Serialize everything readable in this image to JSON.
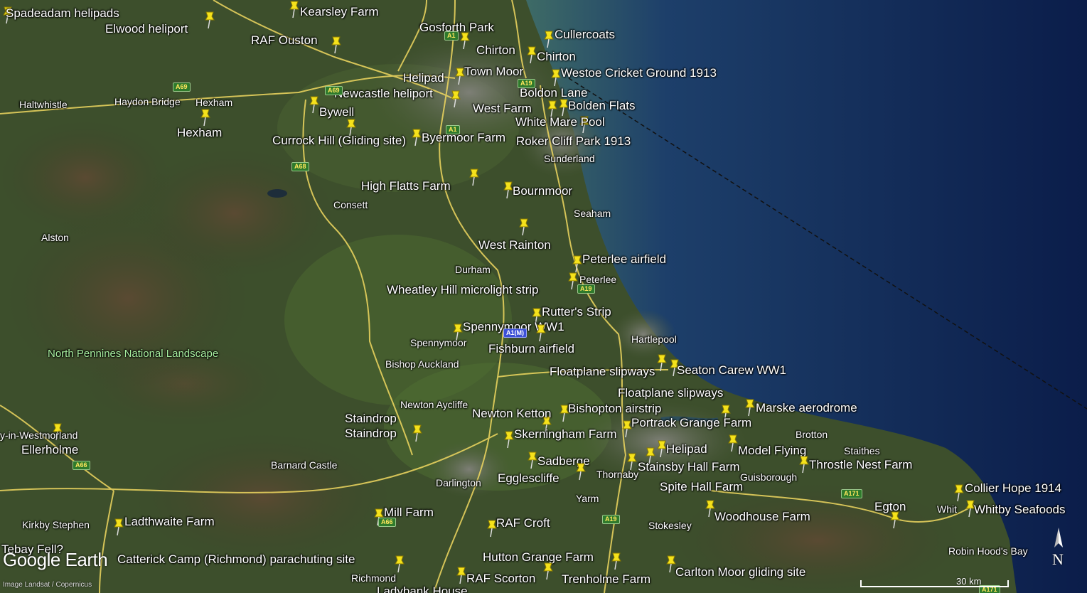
{
  "placemarks": [
    {
      "id": "spadeadam",
      "label": "Spadeadam helipads"
    },
    {
      "id": "elwood",
      "label": "Elwood heliport"
    },
    {
      "id": "kearsley",
      "label": "Kearsley Farm"
    },
    {
      "id": "raf-ouston",
      "label": "RAF Ouston"
    },
    {
      "id": "gosforth",
      "label": "Gosforth Park"
    },
    {
      "id": "cullercoats",
      "label": "Cullercoats"
    },
    {
      "id": "chirton-1",
      "label": "Chirton"
    },
    {
      "id": "chirton-2",
      "label": "Chirton"
    },
    {
      "id": "helipad-1",
      "label": "Helipad"
    },
    {
      "id": "town-moor",
      "label": "Town Moor"
    },
    {
      "id": "westoe",
      "label": "Westoe Cricket Ground 1913"
    },
    {
      "id": "newcastle-heliport",
      "label": "Newcastle heliport"
    },
    {
      "id": "boldon-lane",
      "label": "Boldon Lane"
    },
    {
      "id": "west-farm",
      "label": "West Farm"
    },
    {
      "id": "bolden-flats",
      "label": "Bolden Flats"
    },
    {
      "id": "bywell",
      "label": "Bywell"
    },
    {
      "id": "white-mare",
      "label": "White Mare Pool"
    },
    {
      "id": "hexham-pin",
      "label": "Hexham"
    },
    {
      "id": "currock",
      "label": "Currock Hill (Gliding site)"
    },
    {
      "id": "byermoor",
      "label": "Byermoor Farm"
    },
    {
      "id": "roker",
      "label": "Roker Cliff Park 1913"
    },
    {
      "id": "high-flatts",
      "label": "High Flatts Farm"
    },
    {
      "id": "bournmoor",
      "label": "Bournmoor"
    },
    {
      "id": "west-rainton",
      "label": "West Rainton"
    },
    {
      "id": "peterlee-airfield",
      "label": "Peterlee airfield"
    },
    {
      "id": "wheatley",
      "label": "Wheatley Hill microlight strip"
    },
    {
      "id": "rutters",
      "label": "Rutter's Strip"
    },
    {
      "id": "spennymoor-ww1",
      "label": "Spennymoor WW1"
    },
    {
      "id": "fishburn",
      "label": "Fishburn airfield"
    },
    {
      "id": "floatplane-1",
      "label": "Floatplane slipways"
    },
    {
      "id": "seaton-carew",
      "label": "Seaton Carew WW1"
    },
    {
      "id": "floatplane-2",
      "label": "Floatplane slipways"
    },
    {
      "id": "staindrop-1",
      "label": "Staindrop"
    },
    {
      "id": "staindrop-2",
      "label": "Staindrop"
    },
    {
      "id": "bishopton",
      "label": "Bishopton airstrip"
    },
    {
      "id": "newton-ketton",
      "label": "Newton Ketton"
    },
    {
      "id": "marske",
      "label": "Marske aerodrome"
    },
    {
      "id": "portrack",
      "label": "Portrack Grange Farm"
    },
    {
      "id": "skerningham",
      "label": "Skerningham Farm"
    },
    {
      "id": "helipad-2",
      "label": "Helipad"
    },
    {
      "id": "model-flying",
      "label": "Model Flying"
    },
    {
      "id": "sadberge",
      "label": "Sadberge"
    },
    {
      "id": "stainsby",
      "label": "Stainsby Hall Farm"
    },
    {
      "id": "throstle",
      "label": "Throstle Nest Farm"
    },
    {
      "id": "egglescliffe",
      "label": "Egglescliffe"
    },
    {
      "id": "spite-hall",
      "label": "Spite Hall Farm"
    },
    {
      "id": "ellerholme",
      "label": "Ellerholme"
    },
    {
      "id": "collier-hope",
      "label": "Collier Hope 1914"
    },
    {
      "id": "egton",
      "label": "Egton"
    },
    {
      "id": "whitby-seafoods",
      "label": "Whitby Seafoods"
    },
    {
      "id": "mill-farm",
      "label": "Mill Farm"
    },
    {
      "id": "woodhouse",
      "label": "Woodhouse Farm"
    },
    {
      "id": "ladthwaite",
      "label": "Ladthwaite Farm"
    },
    {
      "id": "raf-croft",
      "label": "RAF Croft"
    },
    {
      "id": "tebay",
      "label": "Tebay Fell?"
    },
    {
      "id": "catterick",
      "label": "Catterick Camp (Richmond) parachuting site"
    },
    {
      "id": "hutton-grange",
      "label": "Hutton Grange Farm"
    },
    {
      "id": "carlton-moor",
      "label": "Carlton Moor gliding site"
    },
    {
      "id": "raf-scorton",
      "label": "RAF Scorton"
    },
    {
      "id": "trenholme",
      "label": "Trenholme Farm"
    },
    {
      "id": "ladybank",
      "label": "Ladybank House"
    }
  ],
  "towns": [
    {
      "id": "haltwhistle",
      "label": "Haltwhistle"
    },
    {
      "id": "haydon-bridge",
      "label": "Haydon Bridge"
    },
    {
      "id": "hexham",
      "label": "Hexham"
    },
    {
      "id": "sunderland",
      "label": "Sunderland"
    },
    {
      "id": "consett",
      "label": "Consett"
    },
    {
      "id": "seaham",
      "label": "Seaham"
    },
    {
      "id": "alston",
      "label": "Alston"
    },
    {
      "id": "durham",
      "label": "Durham"
    },
    {
      "id": "peterlee",
      "label": "Peterlee"
    },
    {
      "id": "hartlepool",
      "label": "Hartlepool"
    },
    {
      "id": "spennymoor",
      "label": "Spennymoor"
    },
    {
      "id": "bishop-auckland",
      "label": "Bishop Auckland"
    },
    {
      "id": "newton-aycliffe",
      "label": "Newton Aycliffe"
    },
    {
      "id": "appleby",
      "label": "y-in-Westmorland"
    },
    {
      "id": "brotton",
      "label": "Brotton"
    },
    {
      "id": "staithes",
      "label": "Staithes"
    },
    {
      "id": "barnard-castle",
      "label": "Barnard Castle"
    },
    {
      "id": "thornaby",
      "label": "Thornaby"
    },
    {
      "id": "guisborough",
      "label": "Guisborough"
    },
    {
      "id": "darlington",
      "label": "Darlington"
    },
    {
      "id": "yarm",
      "label": "Yarm"
    },
    {
      "id": "whitby",
      "label": "Whit"
    },
    {
      "id": "kirkby-stephen",
      "label": "Kirkby Stephen"
    },
    {
      "id": "stokesley",
      "label": "Stokesley"
    },
    {
      "id": "robin-hoods-bay",
      "label": "Robin Hood's Bay"
    },
    {
      "id": "richmond",
      "label": "Richmond"
    }
  ],
  "park": "North Pennines National Landscape",
  "roads": [
    "A69",
    "A69",
    "A1",
    "A19",
    "A1",
    "A68",
    "A1(M)",
    "A19",
    "A66",
    "A19",
    "A171",
    "A66",
    "A171"
  ],
  "branding": {
    "logo": "Google Earth",
    "credit": "Image Landsat / Copernicus"
  },
  "scale": {
    "label": "30 km"
  },
  "compass": {
    "label": "N"
  },
  "colors": {
    "pin": "#f5e21b",
    "sea_dark": "#0d1f4e",
    "sea_shallow": "#3f6e73",
    "land": "#3b4a2a",
    "road": "#f0d860",
    "label": "#ffffff"
  }
}
